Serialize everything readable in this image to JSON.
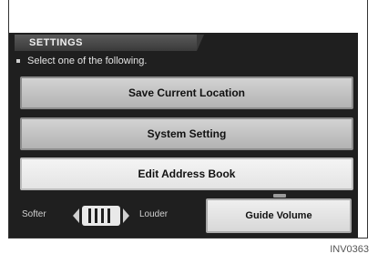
{
  "screen": {
    "title": "SETTINGS",
    "prompt": "Select one of the following."
  },
  "menu": {
    "items": [
      {
        "label": "Save Current Location"
      },
      {
        "label": "System Setting"
      },
      {
        "label": "Edit Address Book"
      }
    ],
    "selected_index": 2
  },
  "volume": {
    "softer_label": "Softer",
    "louder_label": "Louder",
    "guide_button_label": "Guide Volume"
  },
  "figure": {
    "reference_code": "INV0363"
  },
  "colors": {
    "screen_background": "#1f1f1f",
    "button_face": "#c4c4c4",
    "selected_button_face": "#eeeeee"
  }
}
